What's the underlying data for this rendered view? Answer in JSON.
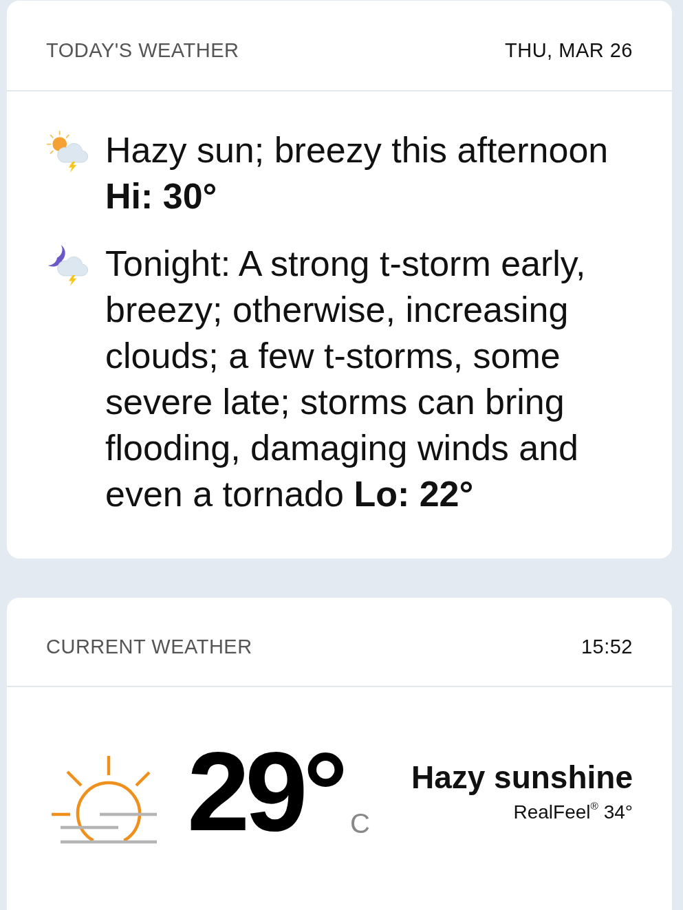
{
  "today": {
    "title": "TODAY'S WEATHER",
    "date": "THU, MAR 26",
    "forecasts": [
      {
        "kind": "day",
        "text": "Hazy sun; breezy this afternoon **Hi: 30°**"
      },
      {
        "kind": "night",
        "text": "Tonight: A strong t-storm early, breezy; otherwise, increasing clouds; a few t-storms, some severe late; storms can bring flooding, damaging winds and even a tornado **Lo: 22°**"
      }
    ]
  },
  "current": {
    "title": "CURRENT WEATHER",
    "time": "15:52",
    "kind": "hazy-sun",
    "temperature": "29°",
    "unit": "C",
    "condition": "Hazy sunshine",
    "realfeel": "RealFeel$^{®}$ 34°"
  }
}
